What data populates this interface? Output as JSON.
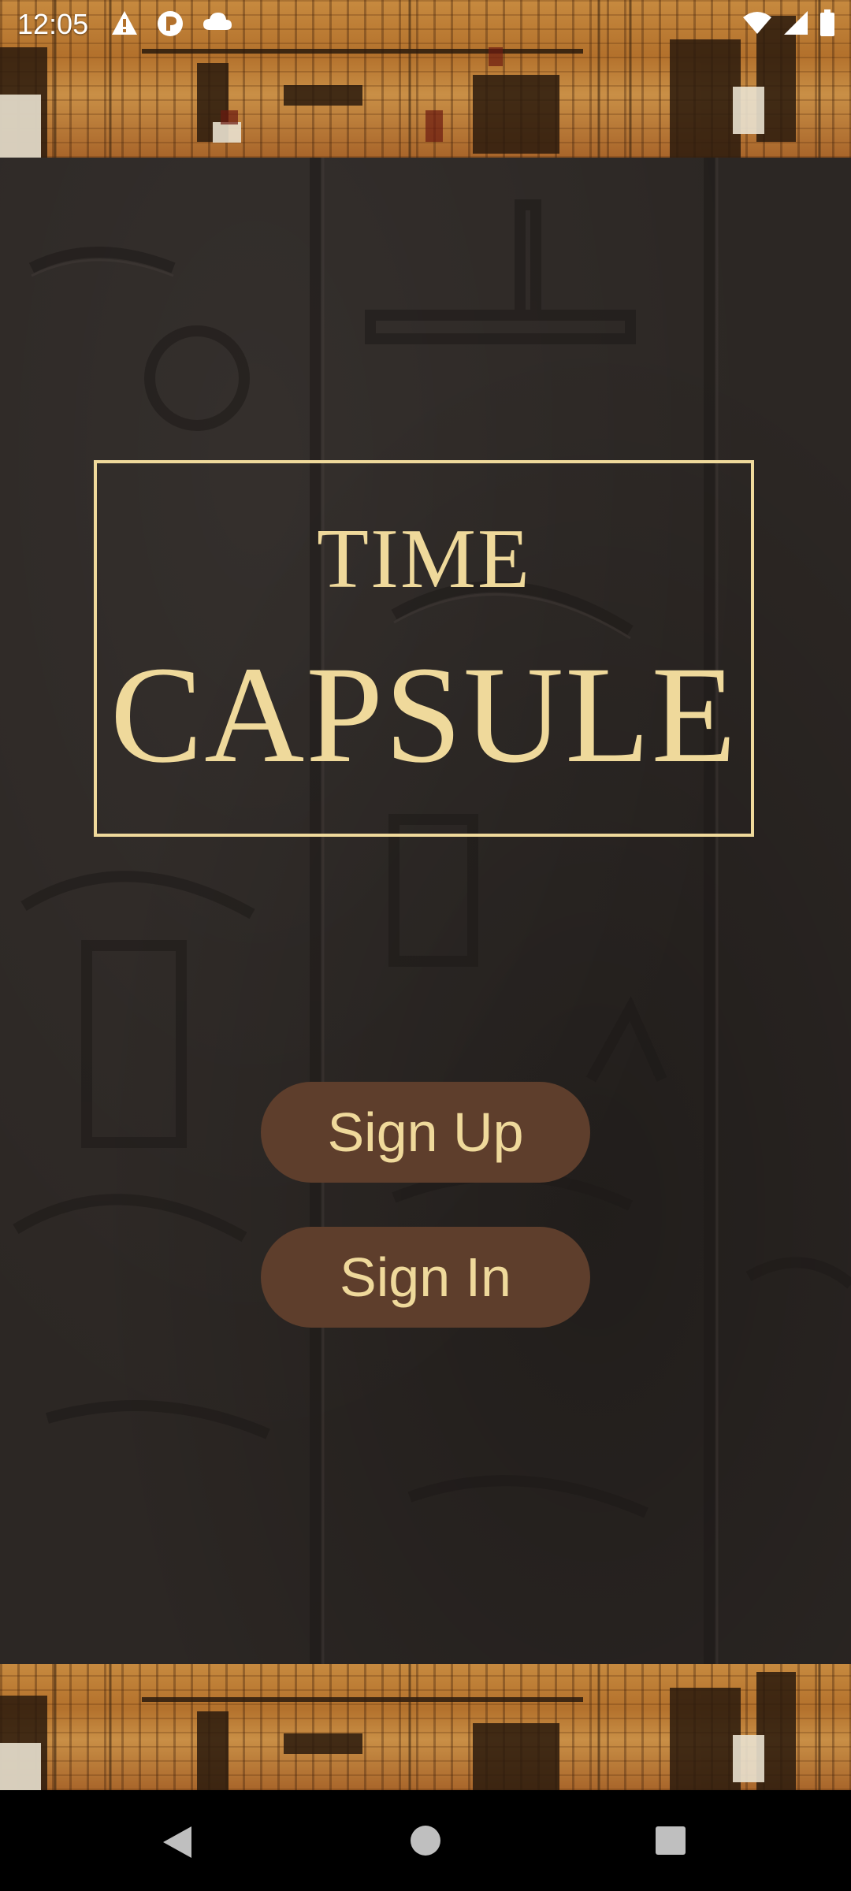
{
  "status_bar": {
    "time": "12:05",
    "left_icons": [
      "warning-icon",
      "shield-icon",
      "cloud-icon"
    ],
    "right_icons": [
      "wifi-icon",
      "signal-icon",
      "battery-icon"
    ]
  },
  "logo": {
    "line1": "TIME",
    "line2": "CAPSULE"
  },
  "buttons": {
    "sign_up": "Sign Up",
    "sign_in": "Sign In"
  },
  "nav_bar": {
    "icons": [
      "back-icon",
      "home-icon",
      "recents-icon"
    ]
  },
  "colors": {
    "accent_gold": "#efd99b",
    "button_brown": "#5e3e2c",
    "wall": "#2c2724",
    "papyrus": "#c78a3f"
  }
}
